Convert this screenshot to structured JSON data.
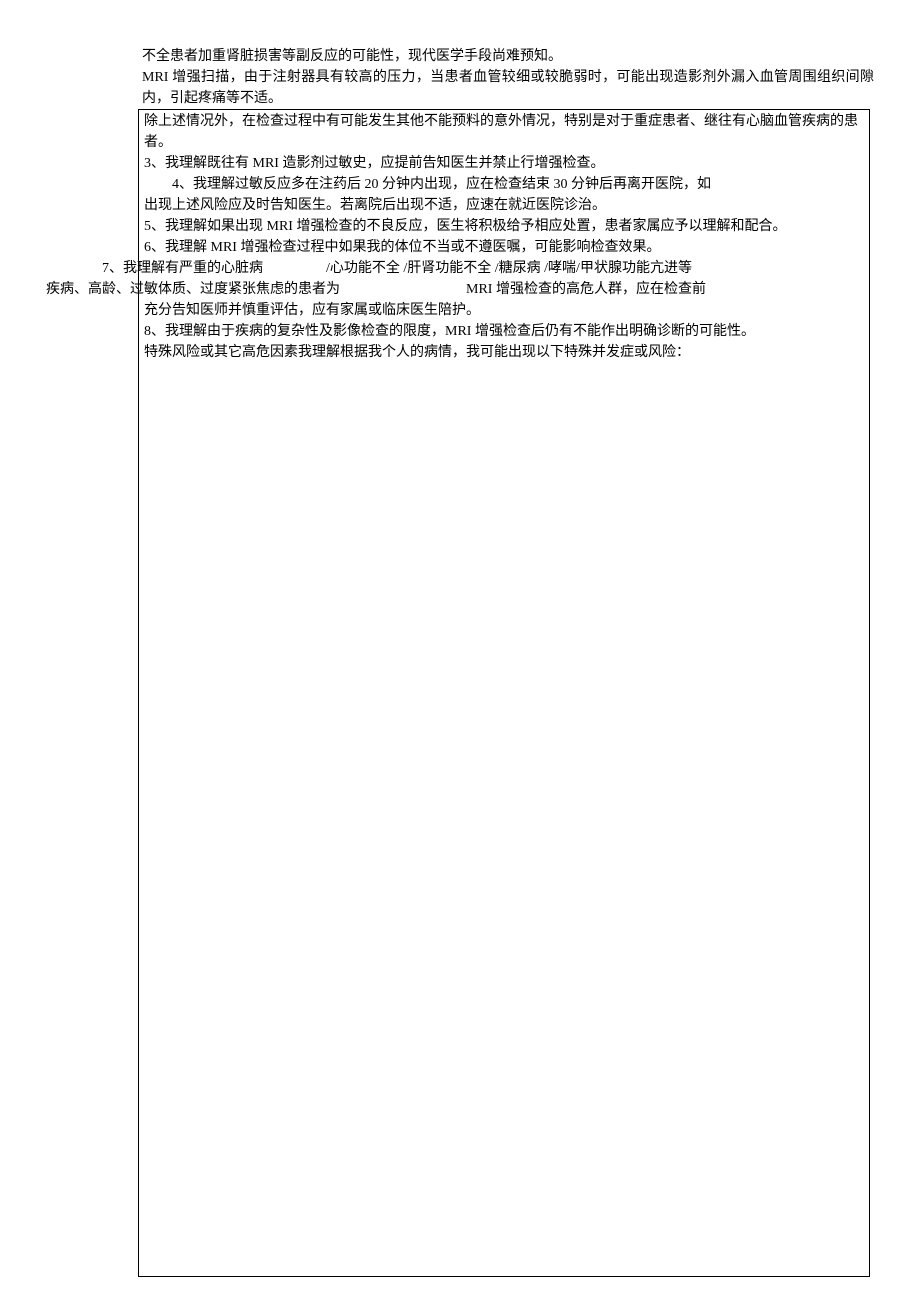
{
  "doc": {
    "line1": "不全患者加重肾脏损害等副反应的可能性，现代医学手段尚难预知。",
    "line2": "MRI 增强扫描，由于注射器具有较高的压力，当患者血管较细或较脆弱时，可能出现造影剂外漏入血管周围组织间隙内，引起疼痛等不适。",
    "boxed_line": "除上述情况外，在检查过程中有可能发生其他不能预料的意外情况，特别是对于重症患者、继往有心脑血管疾病的患者。",
    "item3": "3、我理解既往有 MRI 造影剂过敏史，应提前告知医生并禁止行增强检查。",
    "item4": "4、我理解过敏反应多在注药后 20 分钟内出现，应在检查结束 30 分钟后再离开医院，如",
    "item4_cont": "出现上述风险应及时告知医生。若离院后出现不适，应速在就近医院诊治。",
    "item5": "5、我理解如果出现 MRI 增强检查的不良反应，医生将积极给予相应处置，患者家属应予以理解和配合。",
    "item6": "6、我理解 MRI 增强检查过程中如果我的体位不当或不遵医嘱，可能影响检查效果。",
    "item7_a": "7、我理解有严重的心脏病",
    "item7_b": "/心功能不全   /肝肾功能不全  /糖尿病  /哮喘/甲状腺功能亢进等",
    "item7_line2_a": "疾病、高龄、过敏体质、过度紧张焦虑的患者为",
    "item7_line2_b": "MRI 增强检查的高危人群，应在检查前",
    "item7_line3": "充分告知医师并慎重评估，应有家属或临床医生陪护。",
    "item8": "8、我理解由于疾病的复杂性及影像检查的限度，MRI 增强检查后仍有不能作出明确诊断的可能性。",
    "special": "特殊风险或其它高危因素我理解根据我个人的病情，我可能出现以下特殊并发症或风险："
  }
}
